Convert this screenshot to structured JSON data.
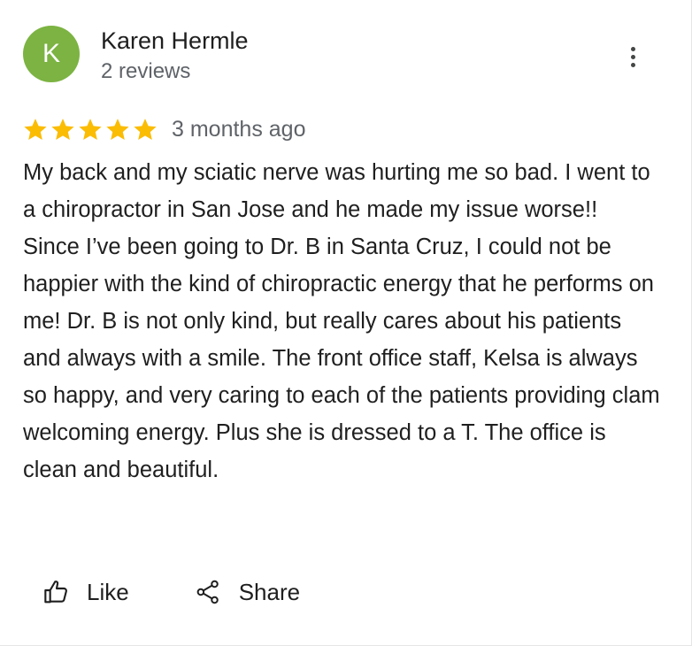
{
  "review": {
    "reviewer": {
      "initial": "K",
      "name": "Karen Hermle",
      "meta": "2 reviews",
      "avatar_color": "#7cb342"
    },
    "more_options_icon": "more-vert-icon",
    "rating": {
      "stars": 5,
      "max_stars": 5,
      "star_color": "#fbbc04"
    },
    "date": "3 months ago",
    "text": "My back and my sciatic nerve was hurting me so bad. I went to a chiropractor in San Jose and he made my issue worse!! Since I’ve been going to Dr. B in Santa Cruz, I could not be happier with the kind of chiropractic energy that he performs on me! Dr. B is not only kind, but really cares about his patients and always with a smile. The front office staff, Kelsa is always so happy, and very caring to each of the patients providing clam welcoming energy. Plus she is dressed to a T. The office is clean and beautiful.",
    "actions": {
      "like_label": "Like",
      "like_icon": "thumb-up-icon",
      "share_label": "Share",
      "share_icon": "share-icon"
    }
  }
}
